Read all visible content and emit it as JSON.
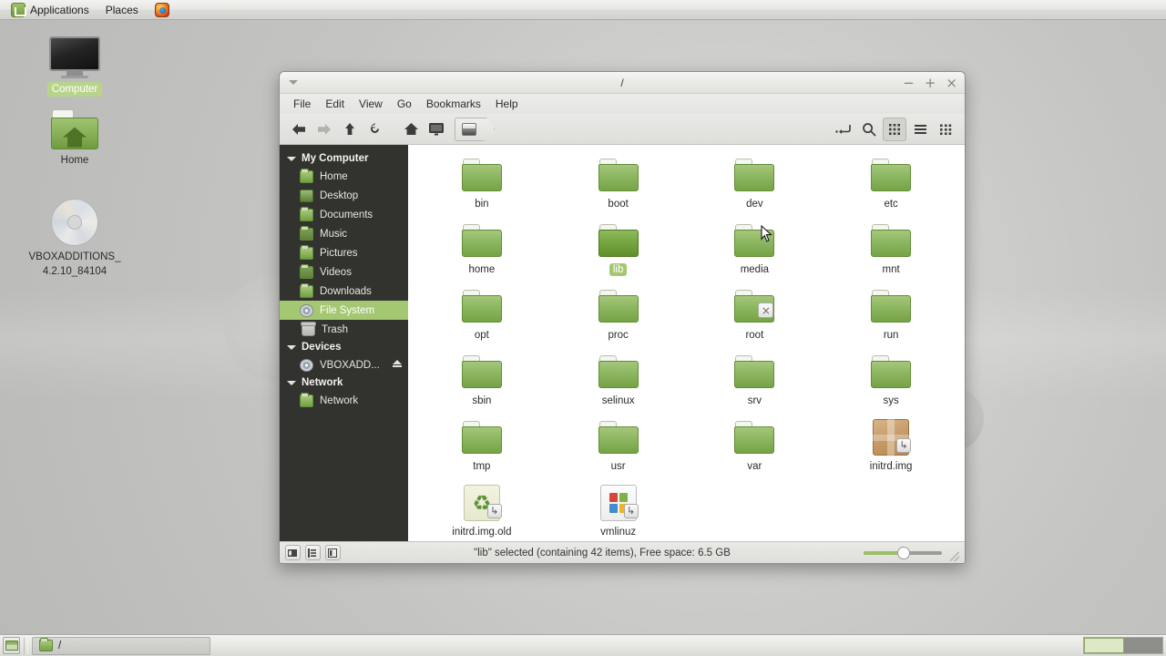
{
  "top_panel": {
    "logo": "linux-mint-logo",
    "applications": "Applications",
    "places": "Places",
    "firefox": "firefox-icon"
  },
  "desktop": {
    "icons": [
      {
        "label": "Computer",
        "icon": "computer-monitor-icon",
        "selected": true
      },
      {
        "label": "Home",
        "icon": "home-folder-icon",
        "selected": false
      },
      {
        "label_line1": "VBOXADDITIONS_",
        "label_line2": "4.2.10_84104",
        "icon": "cd-disc-icon",
        "selected": false
      }
    ]
  },
  "window": {
    "title": "/",
    "controls": {
      "minimize": "−",
      "maximize": "+",
      "close": "×"
    },
    "menu": [
      "File",
      "Edit",
      "View",
      "Go",
      "Bookmarks",
      "Help"
    ],
    "toolbar": {
      "back": "back-arrow",
      "forward": "forward-arrow",
      "up": "up-arrow",
      "reload": "reload-arrow",
      "home": "home-icon",
      "computer": "computer-icon",
      "pathbar_location": "/",
      "location_toggle": "edit-location-icon",
      "search": "search-icon",
      "icon_view": "icon-view",
      "list_view": "list-view",
      "compact_view": "compact-view"
    }
  },
  "sidebar": {
    "groups": [
      {
        "label": "My Computer",
        "items": [
          {
            "label": "Home",
            "icon": "home-folder-icon"
          },
          {
            "label": "Desktop",
            "icon": "desktop-icon"
          },
          {
            "label": "Documents",
            "icon": "documents-folder-icon"
          },
          {
            "label": "Music",
            "icon": "music-folder-icon"
          },
          {
            "label": "Pictures",
            "icon": "pictures-folder-icon"
          },
          {
            "label": "Videos",
            "icon": "videos-folder-icon"
          },
          {
            "label": "Downloads",
            "icon": "downloads-folder-icon"
          },
          {
            "label": "File System",
            "icon": "filesystem-icon",
            "selected": true
          },
          {
            "label": "Trash",
            "icon": "trash-icon"
          }
        ]
      },
      {
        "label": "Devices",
        "items": [
          {
            "label": "VBOXADD...",
            "icon": "disc-icon",
            "eject": "eject-icon"
          }
        ]
      },
      {
        "label": "Network",
        "items": [
          {
            "label": "Network",
            "icon": "network-folder-icon"
          }
        ]
      }
    ]
  },
  "files": [
    {
      "name": "bin",
      "type": "folder"
    },
    {
      "name": "boot",
      "type": "folder"
    },
    {
      "name": "dev",
      "type": "folder"
    },
    {
      "name": "etc",
      "type": "folder"
    },
    {
      "name": "home",
      "type": "folder"
    },
    {
      "name": "lib",
      "type": "folder",
      "selected": true
    },
    {
      "name": "media",
      "type": "folder"
    },
    {
      "name": "mnt",
      "type": "folder"
    },
    {
      "name": "opt",
      "type": "folder"
    },
    {
      "name": "proc",
      "type": "folder"
    },
    {
      "name": "root",
      "type": "folder",
      "emblem": "no-access"
    },
    {
      "name": "run",
      "type": "folder"
    },
    {
      "name": "sbin",
      "type": "folder"
    },
    {
      "name": "selinux",
      "type": "folder"
    },
    {
      "name": "srv",
      "type": "folder"
    },
    {
      "name": "sys",
      "type": "folder"
    },
    {
      "name": "tmp",
      "type": "folder"
    },
    {
      "name": "usr",
      "type": "folder"
    },
    {
      "name": "var",
      "type": "folder"
    },
    {
      "name": "initrd.img",
      "type": "package",
      "emblem": "symlink"
    },
    {
      "name": "initrd.img.old",
      "type": "recycle",
      "emblem": "symlink"
    },
    {
      "name": "vmlinuz",
      "type": "windows",
      "emblem": "symlink"
    }
  ],
  "status": {
    "text": "\"lib\" selected (containing 42 items), Free space: 6.5 GB",
    "zoom_percent": 50,
    "buttons": [
      "places-toggle",
      "tree-toggle",
      "extra-pane-toggle"
    ]
  },
  "taskbar": {
    "show_desktop": "show-desktop-icon",
    "windows": [
      {
        "label": "/",
        "icon": "folder-icon"
      }
    ],
    "workspaces": [
      {
        "active": true
      },
      {
        "active": false
      }
    ]
  },
  "colors": {
    "accent_green": "#a4c871",
    "sidebar_bg": "#32322f",
    "folder_green": "#8fb863"
  }
}
